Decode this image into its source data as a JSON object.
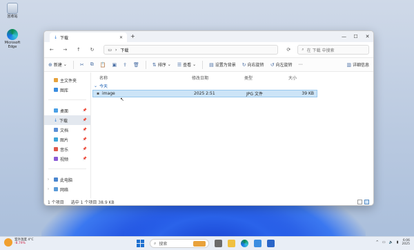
{
  "desktop": {
    "icons": [
      {
        "label": "回收站"
      },
      {
        "label": "Microsoft Edge"
      }
    ]
  },
  "window": {
    "tab_title": "下载",
    "controls": {
      "minimize": "—",
      "maximize": "☐",
      "close": "✕"
    },
    "address": {
      "path_segment": "下载",
      "search_placeholder": "在 下载 中搜索"
    },
    "toolbar": {
      "new_label": "新建",
      "sort_label": "排序",
      "view_label": "查看",
      "set_wallpaper_label": "设置为背景",
      "rotate_right_label": "向右旋转",
      "rotate_left_label": "向左旋转",
      "details_label": "详细信息"
    },
    "sidebar": {
      "items": [
        {
          "label": "主文件夹",
          "pinned": false
        },
        {
          "label": "图库",
          "pinned": false
        },
        {
          "label": "桌面",
          "pinned": true
        },
        {
          "label": "下载",
          "pinned": true
        },
        {
          "label": "文档",
          "pinned": true
        },
        {
          "label": "图片",
          "pinned": true
        },
        {
          "label": "音乐",
          "pinned": true
        },
        {
          "label": "视频",
          "pinned": true
        },
        {
          "label": "此电脑",
          "pinned": false
        },
        {
          "label": "网络",
          "pinned": false
        }
      ]
    },
    "columns": {
      "name": "名称",
      "modified": "修改日期",
      "type": "类型",
      "size": "大小"
    },
    "group_label": "今天",
    "files": [
      {
        "name": "image",
        "modified": "2025 2:51",
        "type": "JPG 文件",
        "size": "39 KB"
      }
    ],
    "status": {
      "count": "1 个项目",
      "selected": "选中 1 个项目  38.9 KB"
    }
  },
  "taskbar": {
    "weather_temp": "室外温度 4°C",
    "weather_sub": "-8.79%",
    "search_placeholder": "搜索",
    "clock_time": "6:06",
    "clock_date": "2025"
  },
  "colors": {
    "accent": "#1c6fd0",
    "selection": "#cce4f7",
    "titlebar": "#eef1f6"
  }
}
